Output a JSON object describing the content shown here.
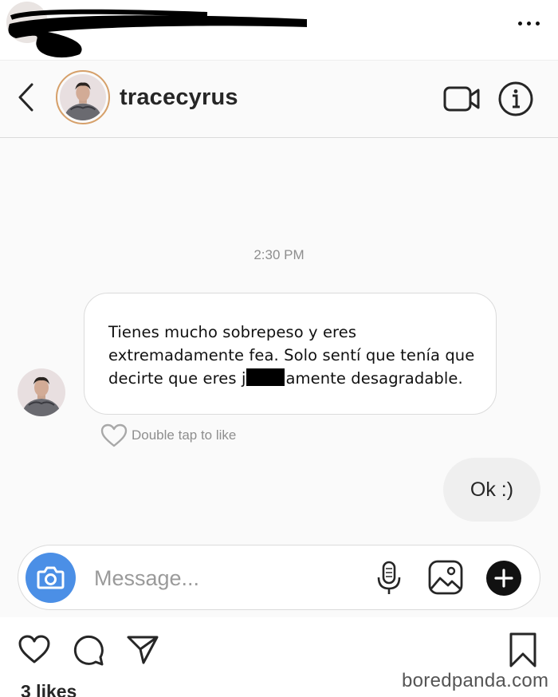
{
  "chat": {
    "username": "tracecyrus",
    "timestamp": "2:30 PM",
    "incoming_message": {
      "text_before_redaction": "Tienes mucho sobrepeso y eres extremadamente fea. Solo sentí que tenía que decirte que eres j",
      "text_after_redaction": "amente desagradable."
    },
    "like_hint": "Double tap to like",
    "outgoing_message": "Ok :)"
  },
  "composer": {
    "placeholder": "Message..."
  },
  "post": {
    "likes": "3 likes"
  },
  "watermark": "boredpanda.com",
  "colors": {
    "camera_button": "#4b8fe6",
    "avatar_ring": "#d6a06a",
    "bubble_out": "#efefef"
  },
  "icons": [
    "more-icon",
    "back-icon",
    "video-call-icon",
    "info-icon",
    "heart-icon",
    "camera-icon",
    "microphone-icon",
    "gallery-icon",
    "plus-icon",
    "comment-icon",
    "share-icon",
    "bookmark-icon"
  ]
}
